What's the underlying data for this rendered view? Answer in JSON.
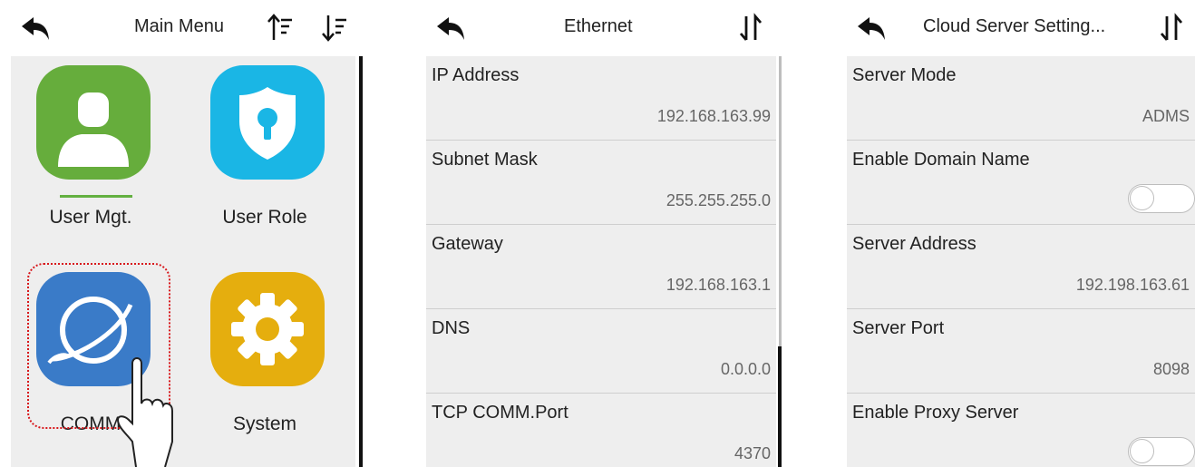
{
  "main_menu": {
    "title": "Main Menu",
    "items": [
      {
        "label": "User Mgt.",
        "icon": "user-icon",
        "color": "#66ad3c"
      },
      {
        "label": "User Role",
        "icon": "shield-icon",
        "color": "#1ab6e5"
      },
      {
        "label": "COMM",
        "icon": "planet-icon",
        "color": "#3a7bc8"
      },
      {
        "label": "System",
        "icon": "gear-icon",
        "color": "#e5ae0e"
      }
    ]
  },
  "ethernet": {
    "title": "Ethernet",
    "rows": [
      {
        "label": "IP Address",
        "value": "192.168.163.99"
      },
      {
        "label": "Subnet Mask",
        "value": "255.255.255.0"
      },
      {
        "label": "Gateway",
        "value": "192.168.163.1"
      },
      {
        "label": "DNS",
        "value": "0.0.0.0"
      },
      {
        "label": "TCP COMM.Port",
        "value": "4370"
      }
    ]
  },
  "cloud": {
    "title": "Cloud Server Setting...",
    "rows": [
      {
        "label": "Server Mode",
        "value": "ADMS"
      },
      {
        "label": "Enable Domain Name",
        "toggle": "off"
      },
      {
        "label": "Server Address",
        "value": "192.198.163.61"
      },
      {
        "label": "Server Port",
        "value": "8098"
      },
      {
        "label": "Enable Proxy Server",
        "toggle": "off"
      }
    ]
  }
}
